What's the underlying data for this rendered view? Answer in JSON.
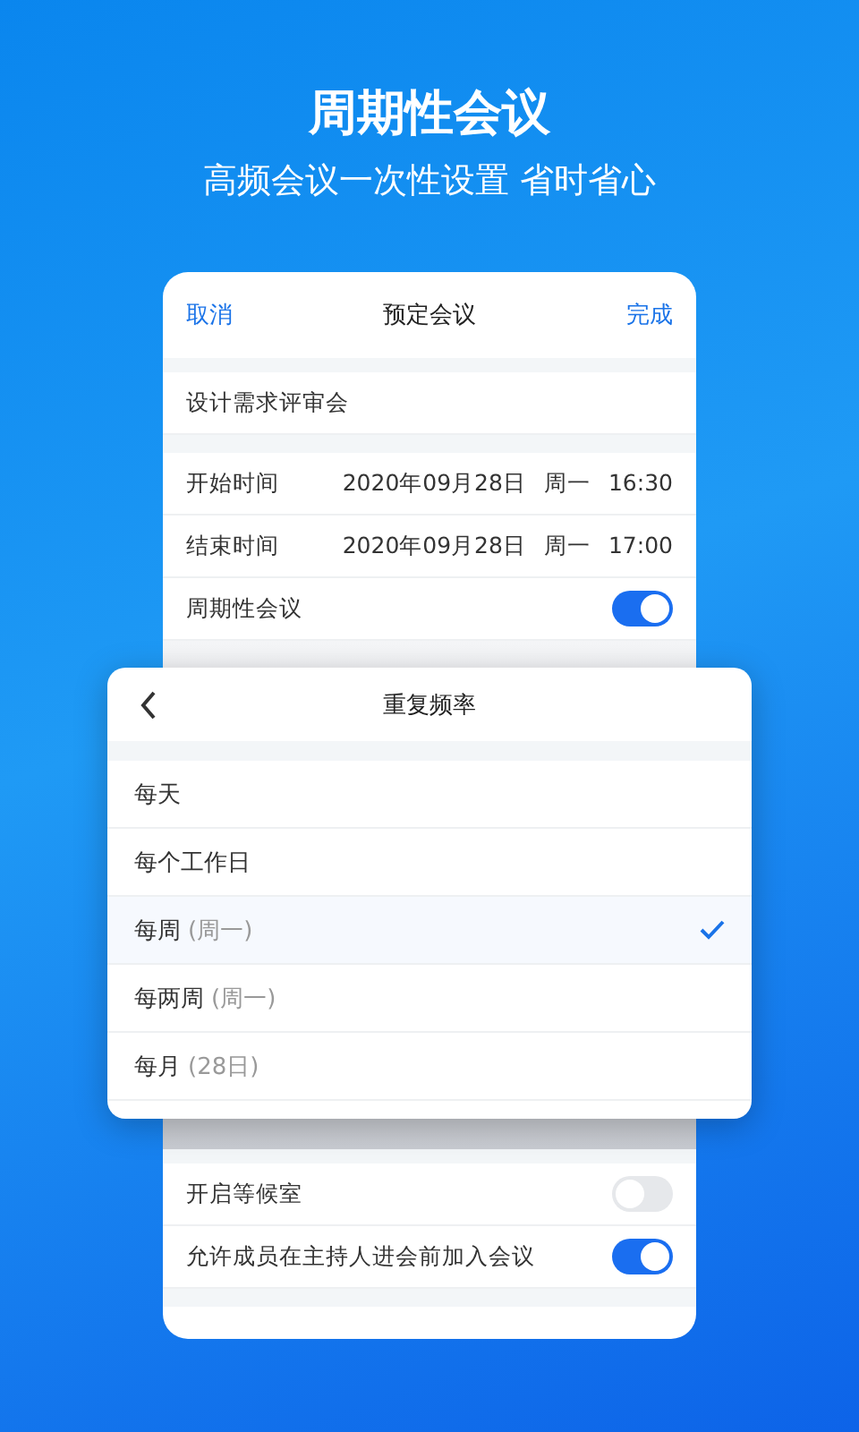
{
  "hero": {
    "title": "周期性会议",
    "subtitle": "高频会议一次性设置 省时省心"
  },
  "card": {
    "header": {
      "cancel": "取消",
      "title": "预定会议",
      "done": "完成"
    },
    "meeting_name": "设计需求评审会",
    "time_rows": [
      {
        "label": "开始时间",
        "date": "2020年09月28日",
        "weekday": "周一",
        "time": "16:30"
      },
      {
        "label": "结束时间",
        "date": "2020年09月28日",
        "weekday": "周一",
        "time": "17:00"
      }
    ],
    "toggles_top": [
      {
        "label": "周期性会议",
        "on": true
      }
    ],
    "toggles_bottom": [
      {
        "label": "开启等候室",
        "on": false
      },
      {
        "label": "允许成员在主持人进会前加入会议",
        "on": true
      }
    ]
  },
  "popup": {
    "title": "重复频率",
    "options": [
      {
        "label": "每天",
        "selected": false
      },
      {
        "label": "每个工作日",
        "selected": false
      },
      {
        "label": "每周",
        "detail": "(周一)",
        "selected": true
      },
      {
        "label": "每两周",
        "detail": "(周一)",
        "selected": false
      },
      {
        "label": "每月",
        "detail": "(28日)",
        "selected": false
      }
    ]
  }
}
